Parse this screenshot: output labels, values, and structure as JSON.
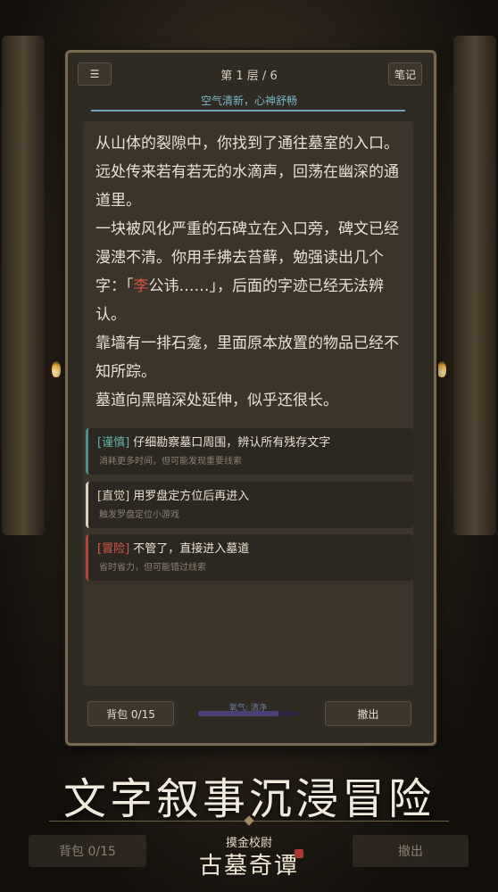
{
  "game": {
    "floor_label": "第 1 层 / 6",
    "menu_icon": "☰",
    "notes_label": "笔记",
    "status_text": "空气清新，心神舒畅"
  },
  "narrative": {
    "p1": "从山体的裂隙中，你找到了通往墓室的入口。远处传来若有若无的水滴声，回荡在幽深的通道里。",
    "p2_before": "一块被风化严重的石碑立在入口旁，碑文已经漫漶不清。你用手拂去苔藓，勉强读出几个字：「",
    "p2_highlight": "李",
    "p2_after": "公讳……」，后面的字迹已经无法辨认。",
    "p3": "靠墙有一排石龛，里面原本放置的物品已经不知所踪。",
    "p4": "墓道向黑暗深处延伸，似乎还很长。"
  },
  "choices": [
    {
      "tag": "[谨慎]",
      "text": " 仔细勘察墓口周围，辨认所有残存文字",
      "hint": "消耗更多时间，但可能发现重要线索"
    },
    {
      "tag": "[直觉]",
      "text": " 用罗盘定方位后再进入",
      "hint": "触发罗盘定位小游戏"
    },
    {
      "tag": "[冒险]",
      "text": " 不管了，直接进入墓道",
      "hint": "省时省力，但可能错过线索"
    }
  ],
  "bottom_bar": {
    "bag_label": "背包 0/15",
    "air_label": "氧气: 清净",
    "air_level": 0.8,
    "undo_label": "撤出"
  },
  "promo": {
    "slogan": "文字叙事沉浸冒险",
    "ghost_bag_label": "背包 0/15",
    "ghost_undo_label": "撤出",
    "logo_top": "摸金校尉",
    "logo_main": "古墓奇谭"
  }
}
